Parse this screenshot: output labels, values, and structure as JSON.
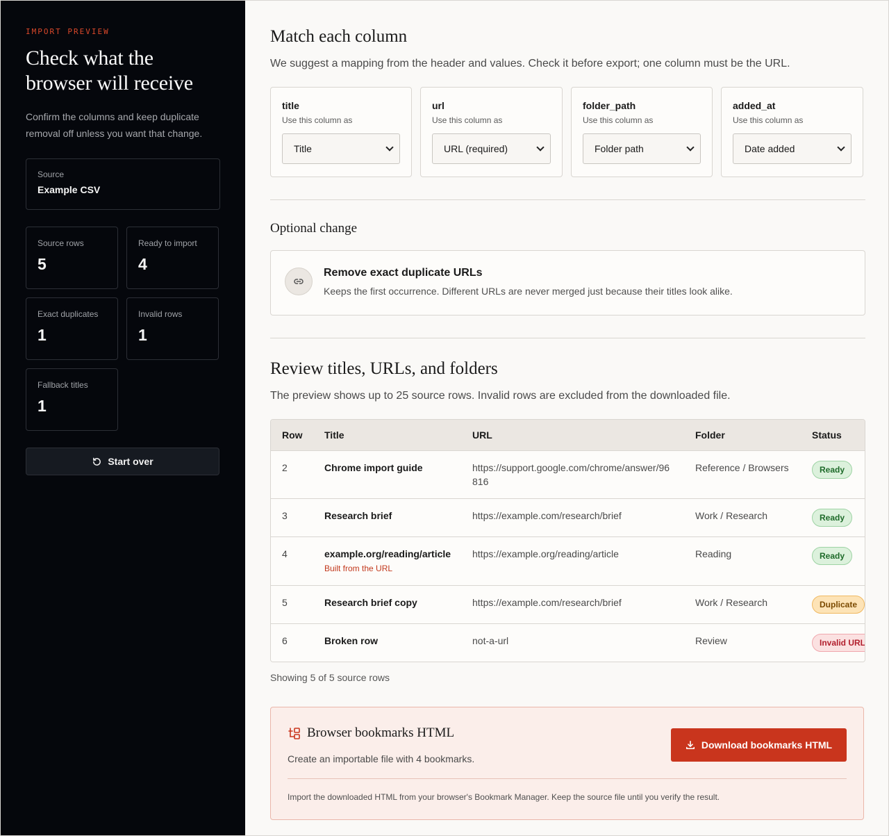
{
  "sidebar": {
    "eyebrow": "IMPORT PREVIEW",
    "title": "Check what the browser will receive",
    "description": "Confirm the columns and keep duplicate removal off unless you want that change.",
    "source": {
      "label": "Source",
      "value": "Example CSV"
    },
    "stats": [
      {
        "label": "Source rows",
        "value": "5"
      },
      {
        "label": "Ready to import",
        "value": "4"
      },
      {
        "label": "Exact duplicates",
        "value": "1"
      },
      {
        "label": "Invalid rows",
        "value": "1"
      },
      {
        "label": "Fallback titles",
        "value": "1"
      }
    ],
    "start_over": "Start over"
  },
  "mapping": {
    "title": "Match each column",
    "lead": "We suggest a mapping from the header and values. Check it before export; one column must be the URL.",
    "use_as": "Use this column as",
    "columns": [
      {
        "header": "title",
        "selected": "Title"
      },
      {
        "header": "url",
        "selected": "URL (required)"
      },
      {
        "header": "folder_path",
        "selected": "Folder path"
      },
      {
        "header": "added_at",
        "selected": "Date added"
      }
    ]
  },
  "optional": {
    "title": "Optional change",
    "option_title": "Remove exact duplicate URLs",
    "option_desc": "Keeps the first occurrence. Different URLs are never merged just because their titles look alike."
  },
  "review": {
    "title": "Review titles, URLs, and folders",
    "lead": "The preview shows up to 25 source rows. Invalid rows are excluded from the downloaded file.",
    "headers": {
      "row": "Row",
      "title": "Title",
      "url": "URL",
      "folder": "Folder",
      "status": "Status"
    },
    "rows": [
      {
        "row": "2",
        "title": "Chrome import guide",
        "note": "",
        "url": "https://support.google.com/chrome/answer/96816",
        "folder": "Reference / Browsers",
        "status": "Ready"
      },
      {
        "row": "3",
        "title": "Research brief",
        "note": "",
        "url": "https://example.com/research/brief",
        "folder": "Work / Research",
        "status": "Ready"
      },
      {
        "row": "4",
        "title": "example.org/reading/article",
        "note": "Built from the URL",
        "url": "https://example.org/reading/article",
        "folder": "Reading",
        "status": "Ready"
      },
      {
        "row": "5",
        "title": "Research brief copy",
        "note": "",
        "url": "https://example.com/research/brief",
        "folder": "Work / Research",
        "status": "Duplicate"
      },
      {
        "row": "6",
        "title": "Broken row",
        "note": "",
        "url": "not-a-url",
        "folder": "Review",
        "status": "Invalid URL"
      }
    ],
    "showing": "Showing 5 of 5 source rows"
  },
  "export": {
    "title": "Browser bookmarks HTML",
    "desc": "Create an importable file with 4 bookmarks.",
    "button": "Download bookmarks HTML",
    "note": "Import the downloaded HTML from your browser's Bookmark Manager. Keep the source file until you verify the result."
  },
  "colors": {
    "sidebar_bg": "#05070c",
    "accent": "#c9351d",
    "ready": "#1f6b2a",
    "duplicate": "#7b4a00",
    "invalid": "#b21f2d"
  }
}
